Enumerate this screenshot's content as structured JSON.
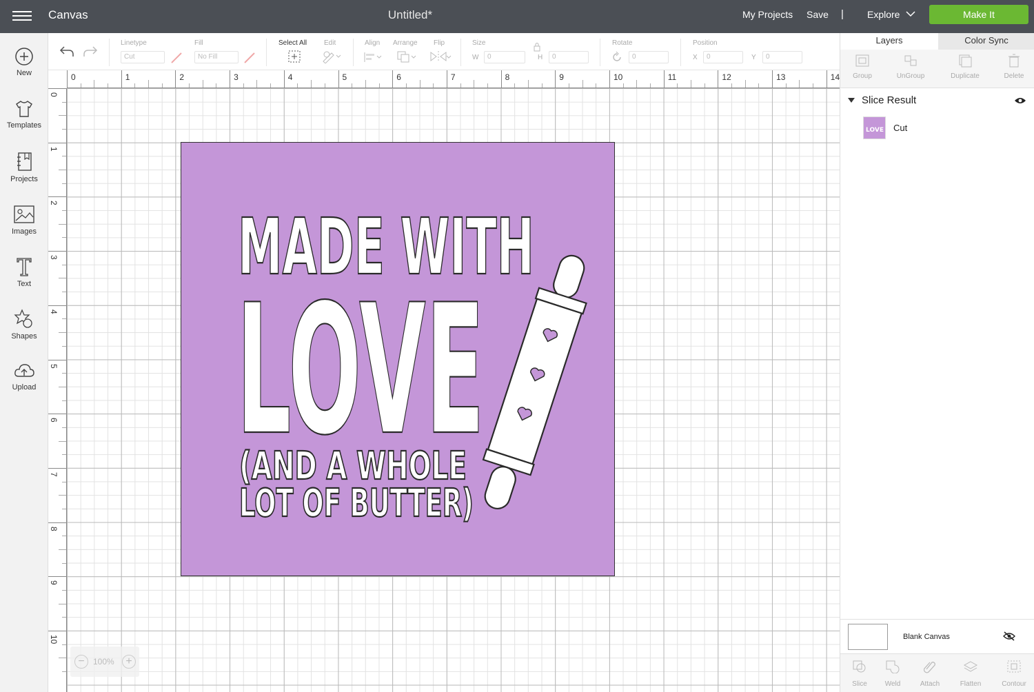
{
  "header": {
    "app_name": "Canvas",
    "document_title": "Untitled*",
    "my_projects": "My Projects",
    "save": "Save",
    "separator": "|",
    "explore": "Explore",
    "make_it": "Make It",
    "make_it_color": "#6bb833",
    "bar_color": "#4b4f55"
  },
  "sidebar": {
    "items": [
      {
        "label": "New",
        "icon": "plus-circle-icon"
      },
      {
        "label": "Templates",
        "icon": "shirt-icon"
      },
      {
        "label": "Projects",
        "icon": "notebook-icon"
      },
      {
        "label": "Images",
        "icon": "image-icon"
      },
      {
        "label": "Text",
        "icon": "text-t-icon"
      },
      {
        "label": "Shapes",
        "icon": "shapes-icon"
      },
      {
        "label": "Upload",
        "icon": "cloud-upload-icon"
      }
    ]
  },
  "toolbar": {
    "linetype_label": "Linetype",
    "linetype_value": "Cut",
    "fill_label": "Fill",
    "fill_value": "No Fill",
    "select_all": "Select All",
    "edit": "Edit",
    "align": "Align",
    "arrange": "Arrange",
    "flip": "Flip",
    "size": "Size",
    "size_w_label": "W",
    "size_w_value": "0",
    "size_h_label": "H",
    "size_h_value": "0",
    "rotate": "Rotate",
    "rotate_value": "0",
    "position": "Position",
    "pos_x_label": "X",
    "pos_x_value": "0",
    "pos_y_label": "Y",
    "pos_y_value": "0"
  },
  "rulers": {
    "horizontal": [
      "0",
      "1",
      "2",
      "3",
      "4",
      "5",
      "6",
      "7",
      "8",
      "9",
      "10",
      "11",
      "12",
      "13",
      "14"
    ],
    "vertical": [
      "0",
      "1",
      "2",
      "3",
      "4",
      "5",
      "6",
      "7",
      "8",
      "9",
      "10"
    ]
  },
  "canvas": {
    "zoom": "100%",
    "design_color": "#c496d8",
    "design_text_line1": "MADE WITH",
    "design_text_line2": "LOVE",
    "design_text_line3": "(AND A WHOLE",
    "design_text_line4": "LOT OF BUTTER)"
  },
  "panel": {
    "tab_layers": "Layers",
    "tab_color_sync": "Color Sync",
    "actions": [
      {
        "label": "Group",
        "icon": "group-icon"
      },
      {
        "label": "UnGroup",
        "icon": "ungroup-icon"
      },
      {
        "label": "Duplicate",
        "icon": "duplicate-icon"
      },
      {
        "label": "Delete",
        "icon": "trash-icon"
      }
    ],
    "group_name": "Slice Result",
    "layer_name": "Cut",
    "layer_thumb_text": "LOVE",
    "blank_canvas": "Blank Canvas",
    "bottom_actions": [
      {
        "label": "Slice",
        "icon": "slice-icon"
      },
      {
        "label": "Weld",
        "icon": "weld-icon"
      },
      {
        "label": "Attach",
        "icon": "attach-icon"
      },
      {
        "label": "Flatten",
        "icon": "flatten-icon"
      },
      {
        "label": "Contour",
        "icon": "contour-icon"
      }
    ]
  }
}
